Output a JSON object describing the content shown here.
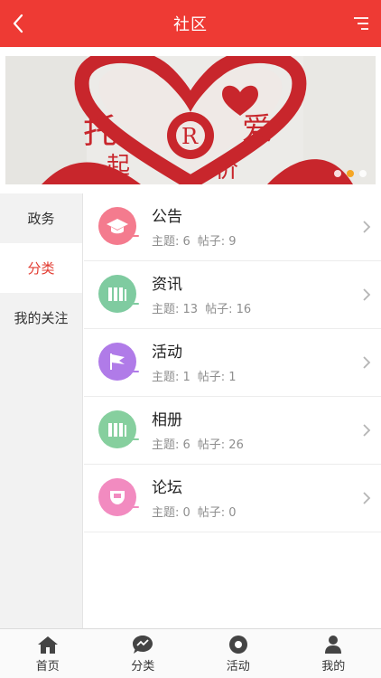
{
  "header": {
    "title": "社区"
  },
  "banner": {
    "dots": 3,
    "active_dot": 1
  },
  "sidebar": {
    "items": [
      {
        "label": "政务",
        "active": false
      },
      {
        "label": "分类",
        "active": true
      },
      {
        "label": "我的关注",
        "active": false
      }
    ]
  },
  "categories": [
    {
      "name": "公告",
      "topics_label": "主题: 6",
      "posts_label": "帖子: 9",
      "icon": "graduation-cap-icon",
      "color": "#f47b8e"
    },
    {
      "name": "资讯",
      "topics_label": "主题: 13",
      "posts_label": "帖子: 16",
      "icon": "books-icon",
      "color": "#7fcba0"
    },
    {
      "name": "活动",
      "topics_label": "主题: 1",
      "posts_label": "帖子: 1",
      "icon": "flag-icon",
      "color": "#b07be8"
    },
    {
      "name": "相册",
      "topics_label": "主题: 6",
      "posts_label": "帖子: 26",
      "icon": "books-icon",
      "color": "#86cf9e"
    },
    {
      "name": "论坛",
      "topics_label": "主题: 0",
      "posts_label": "帖子: 0",
      "icon": "cup-icon",
      "color": "#f28bc0"
    }
  ],
  "tabbar": {
    "items": [
      {
        "label": "首页",
        "icon": "home-icon"
      },
      {
        "label": "分类",
        "icon": "chat-icon"
      },
      {
        "label": "活动",
        "icon": "target-icon"
      },
      {
        "label": "我的",
        "icon": "person-icon"
      }
    ]
  },
  "colors": {
    "brand": "#ee3a34",
    "active_text": "#e23b30",
    "banner_dot_active": "#f5a623"
  }
}
